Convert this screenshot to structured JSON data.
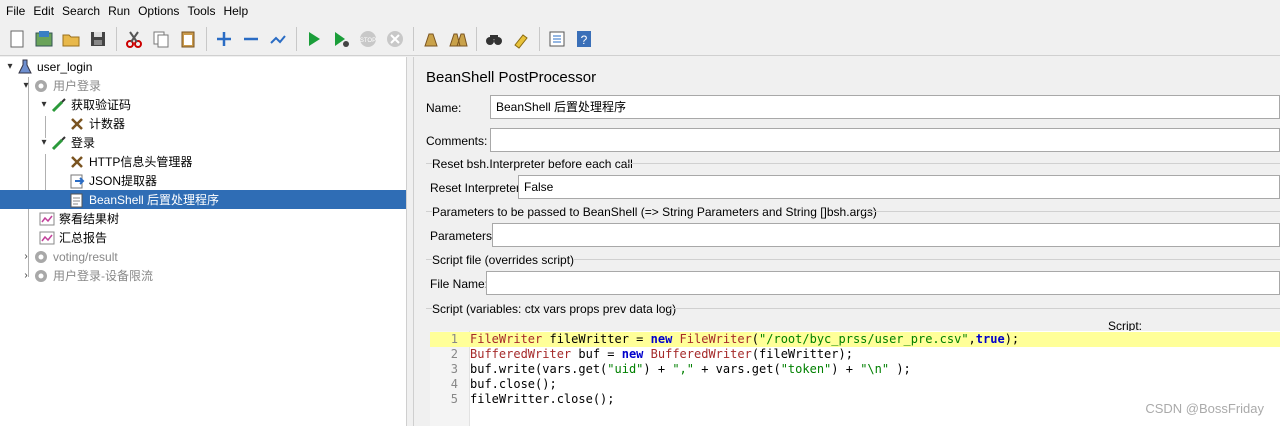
{
  "menu": [
    "File",
    "Edit",
    "Search",
    "Run",
    "Options",
    "Tools",
    "Help"
  ],
  "toolbar_icons": [
    "new-icon",
    "templates-icon",
    "open-icon",
    "save-icon",
    "cut-icon",
    "copy-icon",
    "paste-icon",
    "expand-icon",
    "collapse-icon",
    "toggle-icon",
    "start-icon",
    "start-no-pause-icon",
    "stop-icon",
    "shutdown-icon",
    "clear-icon",
    "clear-all-icon",
    "search-icon",
    "reset-search-icon",
    "function-helper-icon",
    "help-icon"
  ],
  "tree": {
    "items": [
      {
        "label": "user_login",
        "icon": "test-plan-icon"
      },
      {
        "label": "用户登录",
        "icon": "thread-group-icon",
        "disabled": true
      },
      {
        "label": "获取验证码",
        "icon": "sampler-icon"
      },
      {
        "label": "计数器",
        "icon": "config-tool-icon"
      },
      {
        "label": "登录",
        "icon": "sampler-icon"
      },
      {
        "label": "HTTP信息头管理器",
        "icon": "config-tool-icon"
      },
      {
        "label": "JSON提取器",
        "icon": "postprocessor-icon"
      },
      {
        "label": "BeanShell 后置处理程序",
        "icon": "script-icon",
        "selected": true
      },
      {
        "label": "察看结果树",
        "icon": "listener-icon"
      },
      {
        "label": "汇总报告",
        "icon": "listener-icon"
      },
      {
        "label": "voting/result",
        "icon": "thread-group-icon",
        "disabled": true
      },
      {
        "label": "用户登录-设备限流",
        "icon": "thread-group-icon",
        "disabled": true
      }
    ]
  },
  "panel": {
    "title": "BeanShell PostProcessor",
    "name_label": "Name:",
    "name_value": "BeanShell 后置处理程序",
    "comments_label": "Comments:",
    "comments_value": "",
    "reset_section": "Reset bsh.Interpreter before each call",
    "reset_label": "Reset Interpreter:",
    "reset_value": "False",
    "params_section": "Parameters to be passed to BeanShell (=> String Parameters and String []bsh.args)",
    "params_label": "Parameters:",
    "params_value": "",
    "file_section": "Script file (overrides script)",
    "file_label": "File Name:",
    "file_value": "",
    "script_section": "Script (variables: ctx vars props prev data log)",
    "script_label": "Script:"
  },
  "script_lines": [
    "FileWriter fileWritter = new FileWriter(\"/root/byc_prss/user_pre.csv\",true);",
    "BufferedWriter buf = new BufferedWriter(fileWritter);",
    "buf.write(vars.get(\"uid\") + \",\" + vars.get(\"token\") + \"\\n\" );",
    "buf.close();",
    "fileWritter.close();"
  ],
  "watermark": "CSDN @BossFriday"
}
